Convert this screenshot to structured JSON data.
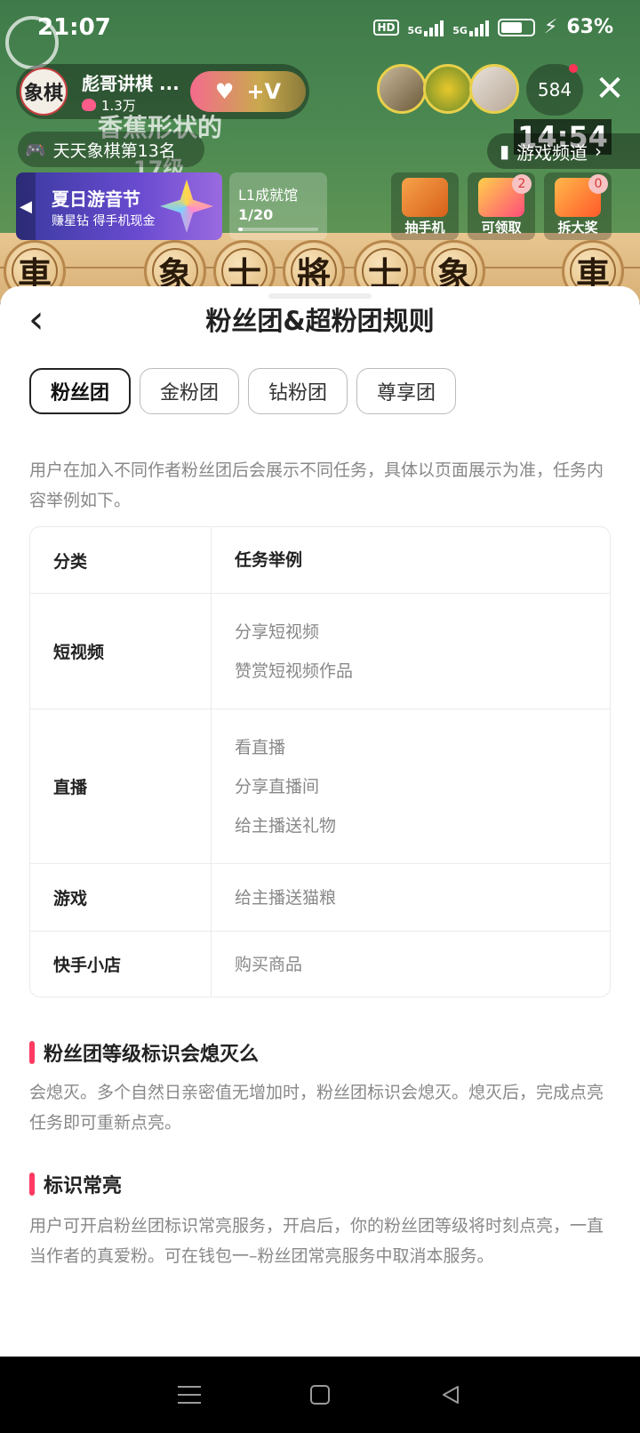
{
  "status": {
    "time": "21:07",
    "hd": "HD",
    "net1": "5G",
    "net2": "5G",
    "battery": "63%"
  },
  "stream": {
    "host_name": "彪哥讲棋 ...",
    "host_avatar_text": "象棋",
    "host_likes": "1.3万",
    "follow_label": "+V",
    "viewer_count": "584",
    "rank_label": "天天象棋第13名",
    "overlay_line1": "香蕉形状的",
    "overlay_line2": "17级",
    "timer": "14:54",
    "game_channel": "游戏频道",
    "banner": {
      "title": "夏日游音节",
      "subtitle": "赚星钻 得手机现金"
    },
    "level": {
      "title": "L1成就馆",
      "progress": "1/20",
      "progress_fraction": 0.05
    },
    "activities": [
      {
        "label": "抽手机",
        "badge": "",
        "color": "#f07a2a"
      },
      {
        "label": "可领取",
        "badge": "2",
        "color": "#ff4d7a"
      },
      {
        "label": "拆大奖",
        "badge": "0",
        "color": "#ff6a3a"
      }
    ],
    "board_pieces": [
      "車",
      "象",
      "士",
      "將",
      "士",
      "象",
      "車"
    ]
  },
  "sheet": {
    "title": "粉丝团&超粉团规则",
    "tabs": [
      "粉丝团",
      "金粉团",
      "钻粉团",
      "尊享团"
    ],
    "active_tab": 0,
    "intro": "用户在加入不同作者粉丝团后会展示不同任务，具体以页面展示为准，任务内容举例如下。",
    "table": {
      "headers": [
        "分类",
        "任务举例"
      ],
      "rows": [
        {
          "category": "短视频",
          "tasks": [
            "分享短视频",
            "赞赏短视频作品"
          ]
        },
        {
          "category": "直播",
          "tasks": [
            "看直播",
            "分享直播间",
            "给主播送礼物"
          ]
        },
        {
          "category": "游戏",
          "tasks": [
            "给主播送猫粮"
          ]
        },
        {
          "category": "快手小店",
          "tasks": [
            "购买商品"
          ]
        }
      ]
    },
    "sections": [
      {
        "title": "粉丝团等级标识会熄灭么",
        "body": "会熄灭。多个自然日亲密值无增加时，粉丝团标识会熄灭。熄灭后，完成点亮任务即可重新点亮。"
      },
      {
        "title": "标识常亮",
        "body": "用户可开启粉丝团标识常亮服务，开启后，你的粉丝团等级将时刻点亮，一直当作者的真爱粉。可在钱包一–粉丝团常亮服务中取消本服务。"
      }
    ]
  },
  "colors": {
    "accent": "#ff3a63",
    "sheet_bg": "#ffffff",
    "muted_text": "#888888"
  }
}
